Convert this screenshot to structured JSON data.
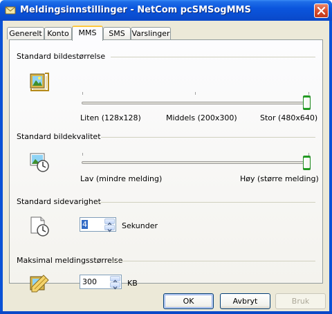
{
  "window": {
    "title": "Meldingsinnstillinger - NetCom pcSMSogMMS"
  },
  "tabs": [
    {
      "label": "Generelt"
    },
    {
      "label": "Konto"
    },
    {
      "label": "MMS"
    },
    {
      "label": "SMS"
    },
    {
      "label": "Varslinger"
    }
  ],
  "active_tab": "MMS",
  "groups": {
    "image_size": {
      "title": "Standard bildestørrelse",
      "slider_value": "Stor (480x640)",
      "labels": {
        "min": "Liten (128x128)",
        "mid": "Middels (200x300)",
        "max": "Stor (480x640)"
      }
    },
    "image_quality": {
      "title": "Standard bildekvalitet",
      "slider_value": "Høy (større melding)",
      "labels": {
        "min": "Lav (mindre melding)",
        "max": "Høy (større melding)"
      }
    },
    "page_duration": {
      "title": "Standard sidevarighet",
      "value": "4",
      "unit": "Sekunder"
    },
    "max_size": {
      "title": "Maksimal meldingsstørrelse",
      "value": "300",
      "unit": "KB"
    }
  },
  "buttons": {
    "ok": "OK",
    "cancel": "Avbryt",
    "apply": "Bruk"
  },
  "colors": {
    "titlebar": "#0a52d6",
    "dialog": "#ece9d8",
    "active_tab_accent": "#ffc83c",
    "slider_thumb": "#21a121"
  }
}
